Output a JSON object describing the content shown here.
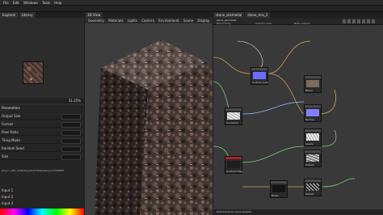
{
  "menubar": {
    "items": [
      "File",
      "Edit",
      "Windows",
      "Tools",
      "Help"
    ]
  },
  "left_panel": {
    "tabs": [
      "Explorer",
      "Library"
    ],
    "zoom": "31.25%",
    "section_header": "Parameters",
    "props": [
      {
        "label": "Output Size"
      },
      {
        "label": "Format"
      },
      {
        "label": "Pixel Ratio"
      },
      {
        "label": "Tiling Mode"
      },
      {
        "label": "Random Seed"
      },
      {
        "label": "Size"
      }
    ],
    "path_text": "pkg://.../sbs_material_blend?dependency=1348187",
    "bottom_labels": [
      "Input 1",
      "Input 2",
      "Input 3"
    ]
  },
  "view3d": {
    "tab": "3D View",
    "menu": [
      "Geometry",
      "Materials",
      "Lights",
      "Camera",
      "Environment",
      "Scene",
      "Display",
      "Renderer"
    ]
  },
  "graph": {
    "tabs": [
      "stone_sbsmatial",
      "stone_mix_2"
    ],
    "breadcrumb": "stone_sbsmatial",
    "toolbar_labels": [
      "Blend Tiling",
      "Uniform Color",
      "Bake Output"
    ],
    "nodes": [
      {
        "name": "Uniform Color",
        "color": "#6b6bff"
      },
      {
        "name": "Normal",
        "color": "#5a7ab8"
      },
      {
        "name": "Blend",
        "color": "#cfcfcf"
      },
      {
        "name": "Curvature",
        "color": "#d8d8d8"
      },
      {
        "name": "Levels",
        "color": "#e6e6e6"
      },
      {
        "name": "Gradient Map",
        "color": "#d94040"
      },
      {
        "name": "Noise",
        "color": "#1a1a1a"
      },
      {
        "name": "Output",
        "color": "#e0e0e0"
      }
    ],
    "status": "Referenced by (local graphs)"
  }
}
